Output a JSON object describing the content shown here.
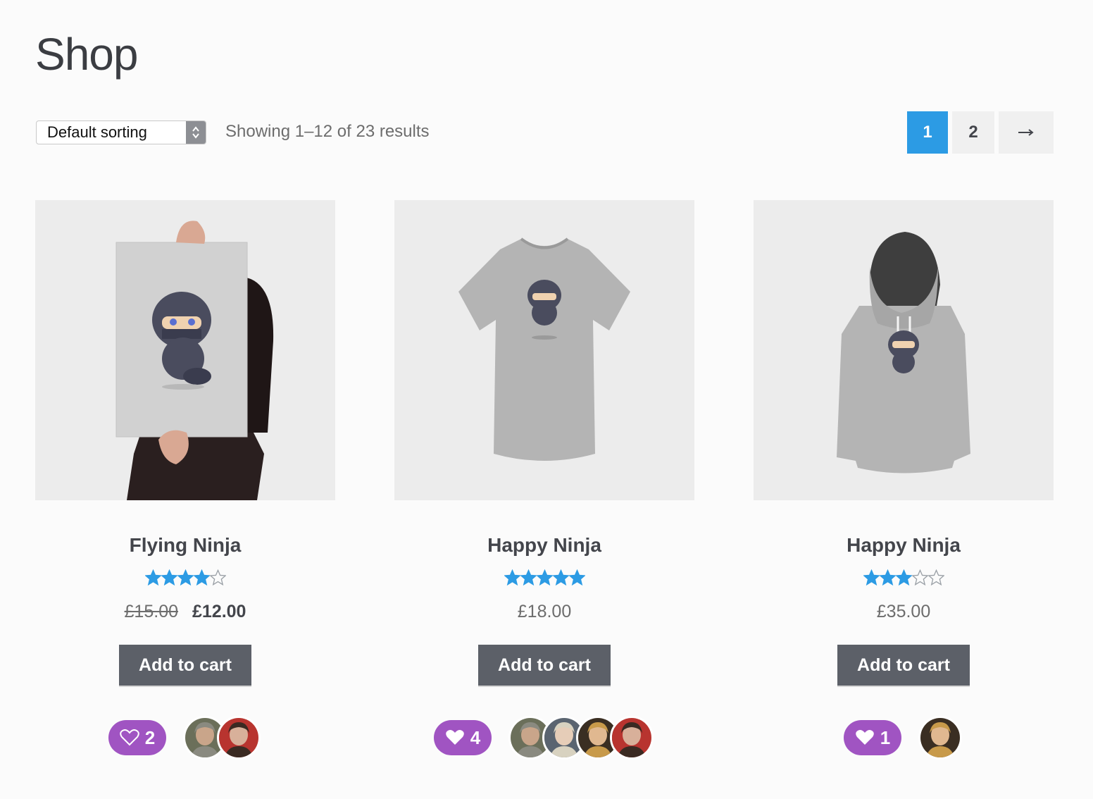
{
  "page": {
    "title": "Shop"
  },
  "toolbar": {
    "sorting_selected": "Default sorting",
    "result_count": "Showing 1–12 of 23 results"
  },
  "pagination": {
    "pages": [
      "1",
      "2"
    ],
    "next": "→",
    "current": "1"
  },
  "products": [
    {
      "title": "Flying Ninja",
      "rating": 4,
      "regular_price": "£15.00",
      "sale_price": "£12.00",
      "button": "Add to cart",
      "likes": "2",
      "liked": false,
      "avatars": [
        "avatar-man-beard",
        "avatar-man-red"
      ]
    },
    {
      "title": "Happy Ninja",
      "rating": 5,
      "price": "£18.00",
      "button": "Add to cart",
      "likes": "4",
      "liked": true,
      "avatars": [
        "avatar-man-beard",
        "avatar-woman-blonde",
        "avatar-woman-braid",
        "avatar-man-red"
      ]
    },
    {
      "title": "Happy Ninja",
      "rating": 3,
      "price": "£35.00",
      "button": "Add to cart",
      "likes": "1",
      "liked": true,
      "avatars": [
        "avatar-woman-braid"
      ]
    }
  ],
  "colors": {
    "accent_blue": "#2c9be4",
    "like_purple": "#a054c2",
    "button_gray": "#5c6068",
    "star_blue": "#2c9be4"
  }
}
